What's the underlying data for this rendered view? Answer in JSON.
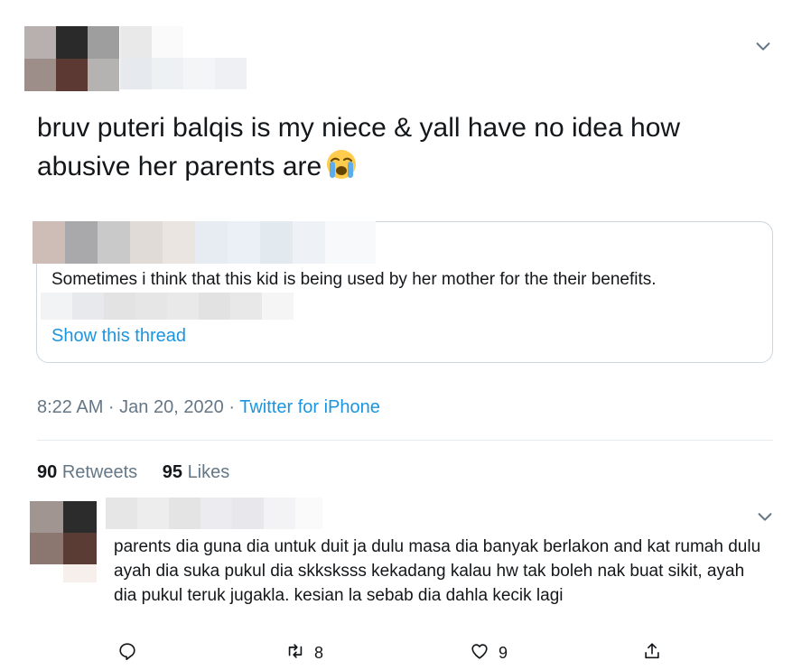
{
  "tweet": {
    "text": "bruv puteri balqis is my niece & yall have no idea how abusive her parents are",
    "emoji": "loudly-crying-face",
    "timestamp": "8:22 AM · Jan 20, 2020",
    "separator": " · ",
    "source": "Twitter for iPhone",
    "retweets_count": "90",
    "retweets_label": "Retweets",
    "likes_count": "95",
    "likes_label": "Likes"
  },
  "quoted_tweet": {
    "text": "Sometimes i think that this kid is being used by her mother for the their benefits.",
    "show_thread_label": "Show this thread"
  },
  "reply": {
    "text": "parents dia guna dia untuk duit ja dulu masa dia banyak berlakon and kat rumah dulu ayah dia suka pukul dia skksksss kekadang kalau hw tak boleh nak buat sikit, ayah dia pukul teruk jugakla. kesian la sebab dia dahla kecik lagi",
    "actions": {
      "reply_count": "",
      "retweet_count": "8",
      "like_count": "9"
    }
  },
  "colors": {
    "link": "#1b95e0",
    "muted": "#657786",
    "border": "#ccd6dd",
    "text": "#14171a"
  },
  "icons": [
    "chevron-down-icon",
    "reply-icon",
    "retweet-icon",
    "like-icon",
    "share-icon"
  ]
}
